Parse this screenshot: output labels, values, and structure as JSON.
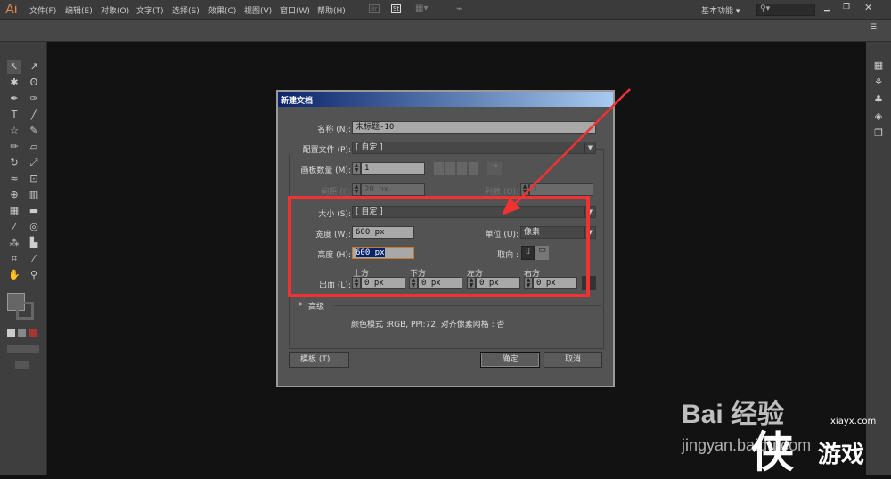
{
  "app": {
    "logo": "Ai",
    "workspace": "基本功能",
    "menus": [
      "文件(F)",
      "编辑(E)",
      "对象(O)",
      "文字(T)",
      "选择(S)",
      "效果(C)",
      "视图(V)",
      "窗口(W)",
      "帮助(H)"
    ],
    "bridge_icon": "Br",
    "stock_icon": "St"
  },
  "dialog": {
    "title": "新建文档",
    "name_label": "名称 (N):",
    "name_value": "未标题-10",
    "profile_label": "配置文件 (P):",
    "profile_value": "[ 自定 ]",
    "artboards_label": "画板数量 (M):",
    "artboards_value": "1",
    "spacing_label": "间距 (I):",
    "spacing_value": "20 px",
    "columns_label": "列数 (O):",
    "columns_value": "1",
    "size_label": "大小 (S):",
    "size_value": "[ 自定 ]",
    "width_label": "宽度 (W):",
    "width_value": "600 px",
    "units_label": "单位 (U):",
    "units_value": "像素",
    "height_label": "高度 (H):",
    "height_value": "600 px",
    "orientation_label": "取向 :",
    "bleed_label": "出血 (L):",
    "bleed": [
      {
        "label": "上方",
        "value": "0 px"
      },
      {
        "label": "下方",
        "value": "0 px"
      },
      {
        "label": "左方",
        "value": "0 px"
      },
      {
        "label": "右方",
        "value": "0 px"
      }
    ],
    "advanced_label": "高级",
    "info": "颜色模式 :RGB, PPI:72, 对齐像素网格 : 否",
    "templates_button": "模板 (T)...",
    "ok_button": "确定",
    "cancel_button": "取消"
  },
  "watermark": {
    "baidu": "Bai 经验",
    "url": "jingyan.baidu.com",
    "site": "xiayx.com",
    "site_name": "游戏"
  },
  "colors": {
    "highlight": "#f03232",
    "titlebar": "#0a246a"
  }
}
